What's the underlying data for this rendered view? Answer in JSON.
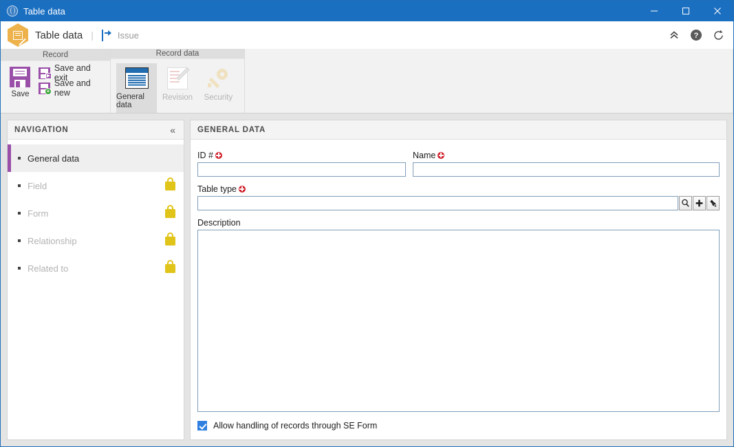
{
  "titlebar": {
    "title": "Table data",
    "icon": "globe-icon",
    "minimize": "–",
    "maximize": "□",
    "close": "✕"
  },
  "appheader": {
    "logo_icon": "document-edit-hexagon-icon",
    "title": "Table data",
    "separator": "|",
    "issue_icon": "issue-arrow-icon",
    "issue_label": "Issue",
    "collapse_ribbon_icon": "chevron-double-up-icon",
    "help_icon": "help-circle-icon",
    "refresh_icon": "refresh-icon"
  },
  "ribbon": {
    "groups": [
      {
        "title": "Record",
        "big_button": {
          "label": "Save",
          "icon": "floppy-disk-icon"
        },
        "small_buttons": [
          {
            "label": "Save and exit",
            "icon": "floppy-disk-exit-icon"
          },
          {
            "label": "Save and new",
            "icon": "floppy-disk-new-icon"
          }
        ]
      },
      {
        "title": "Record data",
        "buttons": [
          {
            "label": "General data",
            "icon": "general-data-icon",
            "state": "active"
          },
          {
            "label": "Revision",
            "icon": "revision-document-icon",
            "state": "disabled"
          },
          {
            "label": "Security",
            "icon": "key-icon",
            "state": "disabled"
          }
        ]
      }
    ]
  },
  "navigation": {
    "header": "NAVIGATION",
    "collapse_icon": "chevron-double-left-icon",
    "items": [
      {
        "label": "General data",
        "locked": false,
        "selected": true
      },
      {
        "label": "Field",
        "locked": true,
        "selected": false
      },
      {
        "label": "Form",
        "locked": true,
        "selected": false
      },
      {
        "label": "Relationship",
        "locked": true,
        "selected": false
      },
      {
        "label": "Related to",
        "locked": true,
        "selected": false
      }
    ],
    "lock_icon": "lock-icon"
  },
  "main": {
    "header": "GENERAL DATA",
    "fields": {
      "id": {
        "label": "ID #",
        "required": true,
        "value": "",
        "placeholder": ""
      },
      "name": {
        "label": "Name",
        "required": true,
        "value": "",
        "placeholder": ""
      },
      "table_type": {
        "label": "Table type",
        "required": true,
        "value": "",
        "placeholder": "",
        "buttons": [
          {
            "icon": "search-icon",
            "name": "search-button"
          },
          {
            "icon": "plus-icon",
            "name": "add-button"
          },
          {
            "icon": "brush-icon",
            "name": "clear-button"
          }
        ]
      },
      "description": {
        "label": "Description",
        "required": false,
        "value": "",
        "placeholder": ""
      }
    },
    "checkbox": {
      "label": "Allow handling of records through SE Form",
      "checked": true
    }
  },
  "colors": {
    "titlebar": "#1b6fc1",
    "accent_purple": "#9a4fa8",
    "logo_orange": "#edb24b",
    "required_red": "#d0202a",
    "lock_yellow": "#e0c419",
    "checkbox_blue": "#2e7fe0",
    "icon_blue": "#1f6cb0"
  }
}
